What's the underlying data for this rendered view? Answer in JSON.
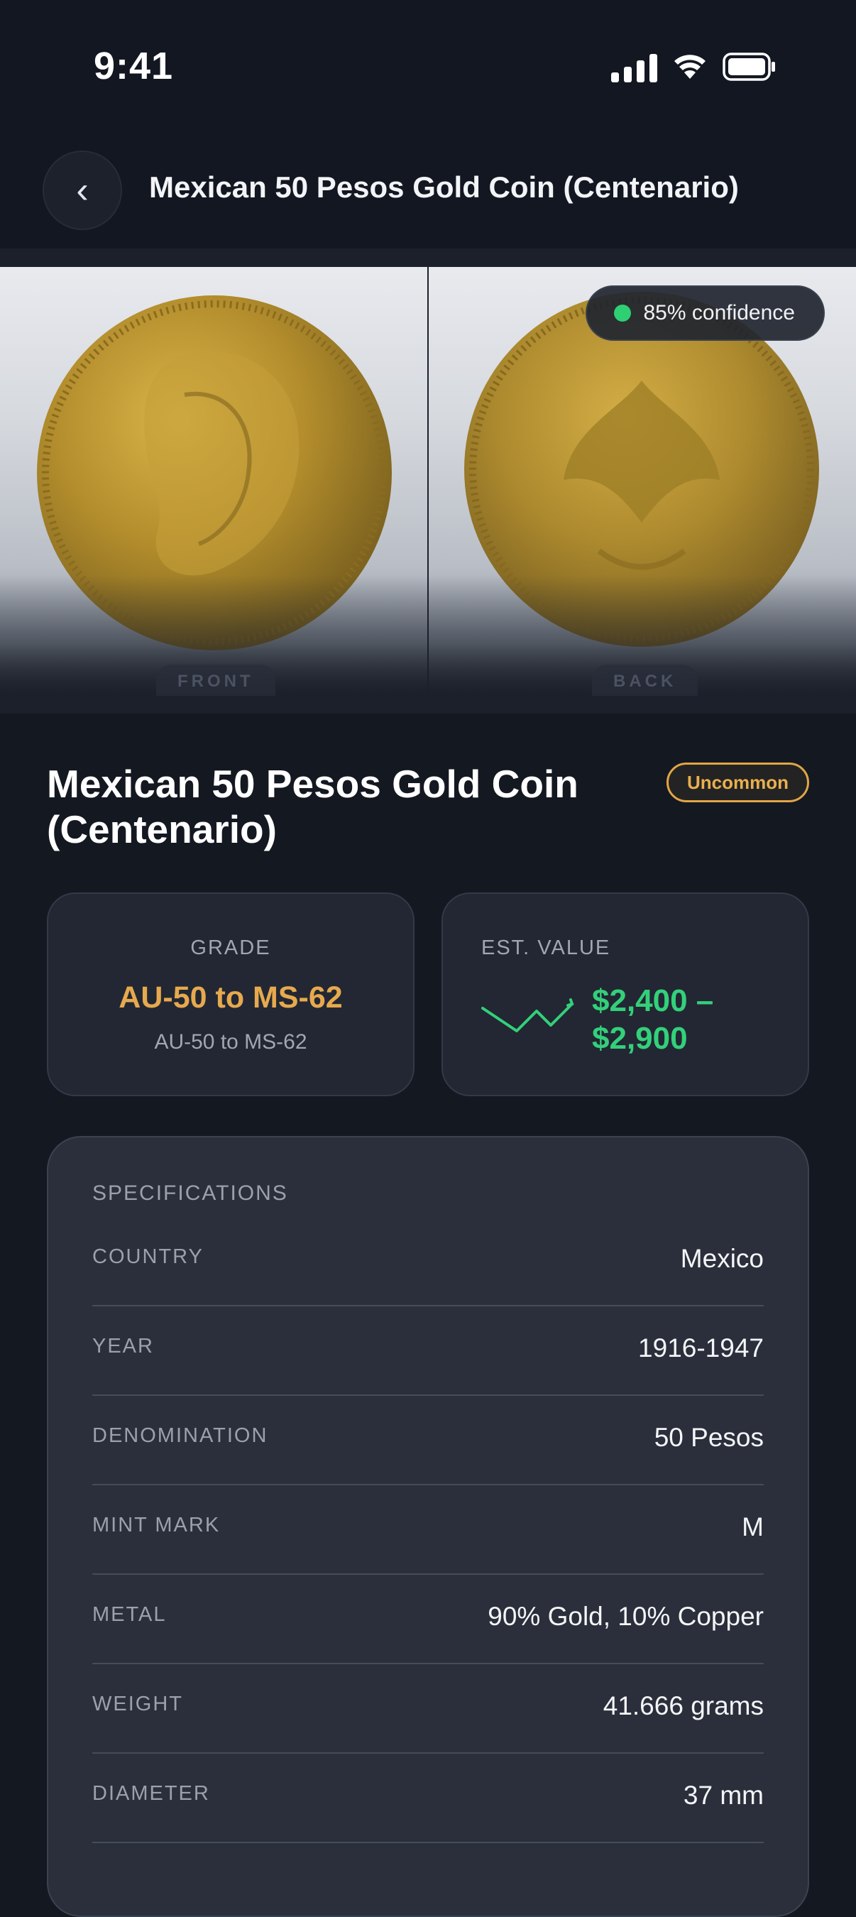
{
  "status_bar": {
    "time": "9:41",
    "icons": [
      "cellular-signal-icon",
      "wifi-icon",
      "battery-icon"
    ]
  },
  "header": {
    "back_icon": "‹",
    "title": "Mexican 50 Pesos Gold Coin (Centenario)"
  },
  "photos": {
    "front_label": "FRONT",
    "back_label": "BACK",
    "confidence": "85% confidence",
    "confidence_color": "#2fcf73"
  },
  "coin": {
    "title": "Mexican 50 Pesos Gold Coin (Centenario)",
    "rarity": "Uncommon"
  },
  "grade": {
    "caption": "GRADE",
    "value": "AU-50 to MS-62",
    "sub": "AU-50 to MS-62"
  },
  "value": {
    "caption": "EST. VALUE",
    "amount": "$2,400 – $2,900",
    "trend_icon": "trend-line-icon"
  },
  "specs": {
    "title": "SPECIFICATIONS",
    "rows": [
      {
        "label": "COUNTRY",
        "value": "Mexico"
      },
      {
        "label": "YEAR",
        "value": "1916-1947"
      },
      {
        "label": "DENOMINATION",
        "value": "50 Pesos"
      },
      {
        "label": "MINT MARK",
        "value": "M"
      },
      {
        "label": "METAL",
        "value": "90% Gold, 10% Copper"
      },
      {
        "label": "WEIGHT",
        "value": "41.666 grams"
      },
      {
        "label": "DIAMETER",
        "value": "37 mm"
      }
    ]
  },
  "colors": {
    "background": "#141821",
    "accent_gold": "#e7a94d",
    "accent_green": "#33d07a"
  }
}
